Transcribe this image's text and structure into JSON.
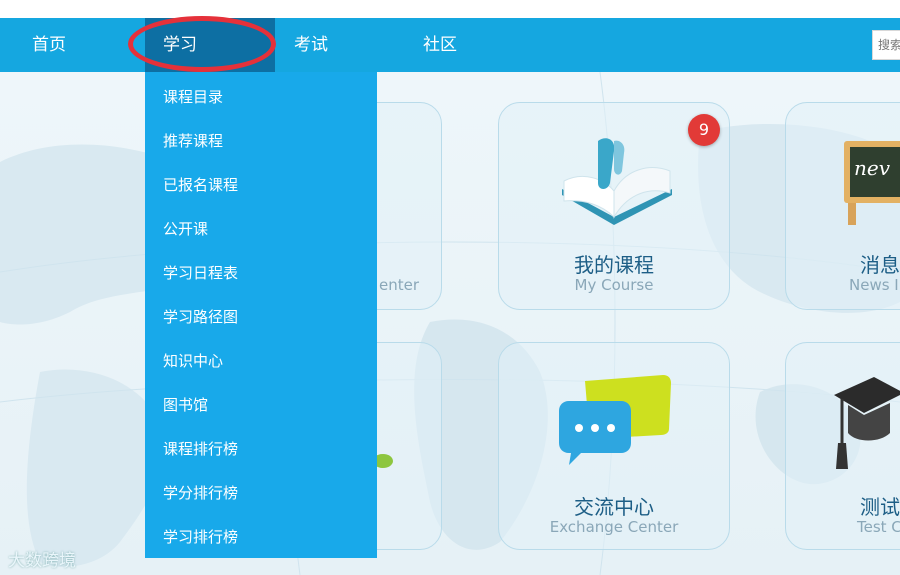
{
  "nav": {
    "items": [
      "首页",
      "学习",
      "考试",
      "社区"
    ],
    "active": "学习",
    "search_text": "搜索"
  },
  "dropdown": {
    "items": [
      "课程目录",
      "推荐课程",
      "已报名课程",
      "公开课",
      "学习日程表",
      "学习路径图",
      "知识中心",
      "图书馆",
      "课程排行榜",
      "学分排行榜",
      "学习排行榜"
    ]
  },
  "tiles": [
    {
      "title": "",
      "subtitle": "enter",
      "icon": "hidden-tile-icon"
    },
    {
      "title": "我的课程",
      "subtitle": "My Course",
      "badge": "9",
      "icon": "open-book-icon"
    },
    {
      "title": "消息",
      "subtitle": "News I",
      "icon": "news-chalkboard-icon"
    },
    {
      "title": "",
      "subtitle": "",
      "icon": "partial-green-icon"
    },
    {
      "title": "交流中心",
      "subtitle": "Exchange Center",
      "icon": "chat-bubbles-icon"
    },
    {
      "title": "测试",
      "subtitle": "Test C",
      "icon": "graduation-cap-icon"
    }
  ],
  "watermark": "大数跨境",
  "colors": {
    "nav": "#15a7e0",
    "nav_active": "#0d6fa3",
    "dropdown": "#18a9ea",
    "annotation": "#e5313a",
    "badge": "#e23a37"
  }
}
